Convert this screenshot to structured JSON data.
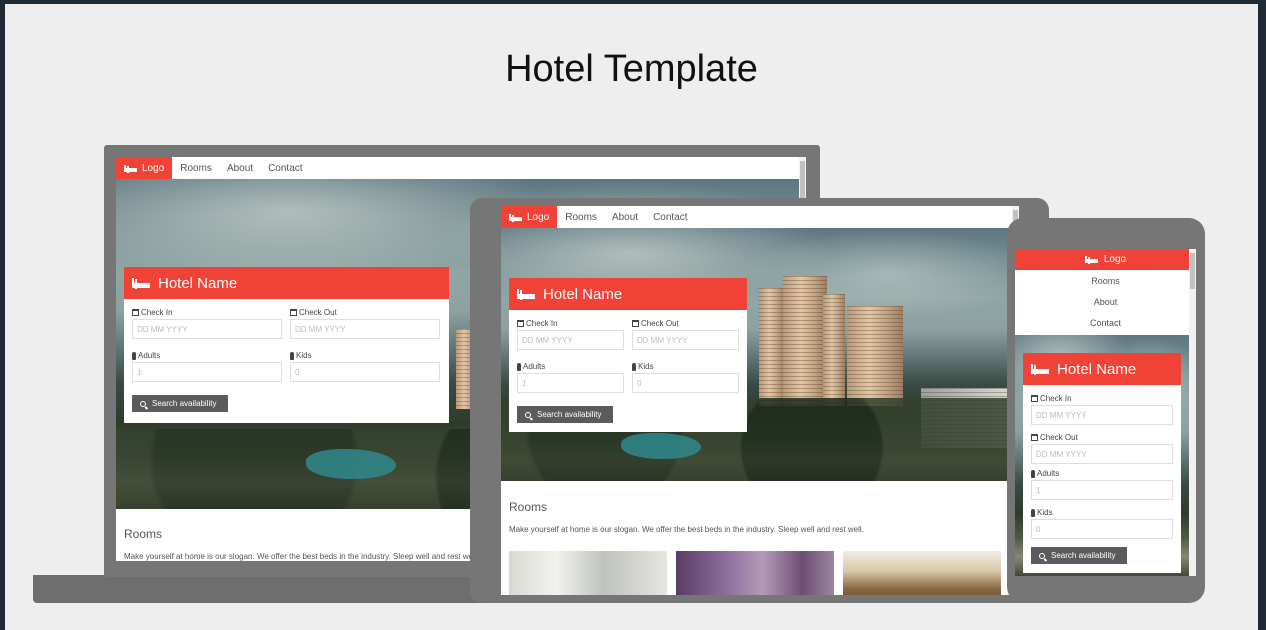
{
  "page": {
    "title": "Hotel Template"
  },
  "site": {
    "logo_label": "Logo",
    "nav": [
      "Rooms",
      "About",
      "Contact"
    ],
    "hotel_name": "Hotel Name",
    "form": {
      "check_in_label": "Check In",
      "check_out_label": "Check Out",
      "date_placeholder": "DD MM YYYY",
      "adults_label": "Adults",
      "adults_value": "1",
      "kids_label": "Kids",
      "kids_value": "0",
      "search_label": "Search availability"
    },
    "rooms_heading": "Rooms",
    "slogan": "Make yourself at home is our slogan. We offer the best beds in the industry. Sleep well and rest well.",
    "slogan_cut": "Make yourself at home is our slogan. We offer the best beds in the industry. Sleep well and rest well."
  },
  "icons": [
    "bed-icon",
    "calendar-icon",
    "female-icon",
    "male-icon",
    "search-icon"
  ],
  "colors": {
    "accent": "#f04236",
    "button": "#5b5b5b",
    "device_frame": "#767676",
    "background": "#eeeeee"
  }
}
